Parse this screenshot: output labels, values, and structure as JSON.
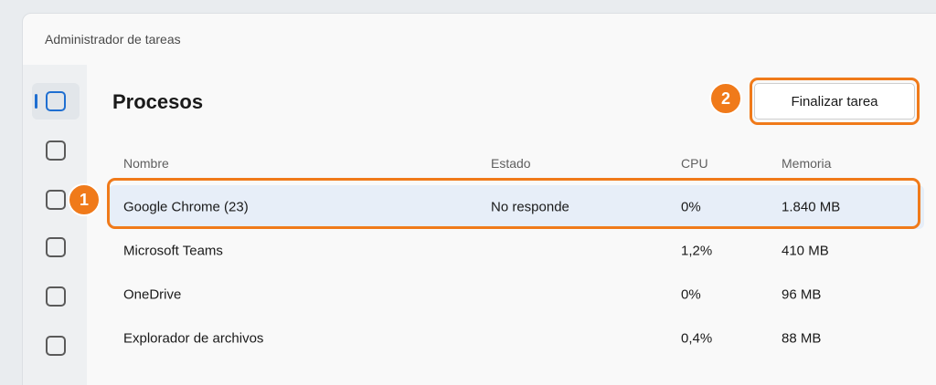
{
  "window": {
    "title": "Administrador de tareas"
  },
  "nav": {
    "items": [
      {
        "icon": "processes-icon",
        "active": true
      },
      {
        "icon": "performance-icon",
        "active": false
      },
      {
        "icon": "app-history-icon",
        "active": false
      },
      {
        "icon": "startup-apps-icon",
        "active": false
      },
      {
        "icon": "users-icon",
        "active": false
      },
      {
        "icon": "details-icon",
        "active": false
      }
    ]
  },
  "page": {
    "title": "Procesos"
  },
  "toolbar": {
    "end_task_label": "Finalizar tarea"
  },
  "table": {
    "headers": {
      "name": "Nombre",
      "status": "Estado",
      "cpu": "CPU",
      "memory": "Memoria"
    },
    "rows": [
      {
        "name": "Google Chrome (23)",
        "status": "No responde",
        "cpu": "0%",
        "memory": "1.840 MB",
        "selected": true
      },
      {
        "name": "Microsoft Teams",
        "status": "",
        "cpu": "1,2%",
        "memory": "410 MB",
        "selected": false
      },
      {
        "name": "OneDrive",
        "status": "",
        "cpu": "0%",
        "memory": "96 MB",
        "selected": false
      },
      {
        "name": "Explorador de archivos",
        "status": "",
        "cpu": "0,4%",
        "memory": "88 MB",
        "selected": false
      }
    ]
  },
  "annotations": {
    "step1": "1",
    "step2": "2",
    "highlight_color": "#f07a1a"
  },
  "colors": {
    "accent": "#1f6fd1",
    "selection": "#e7eef8"
  }
}
